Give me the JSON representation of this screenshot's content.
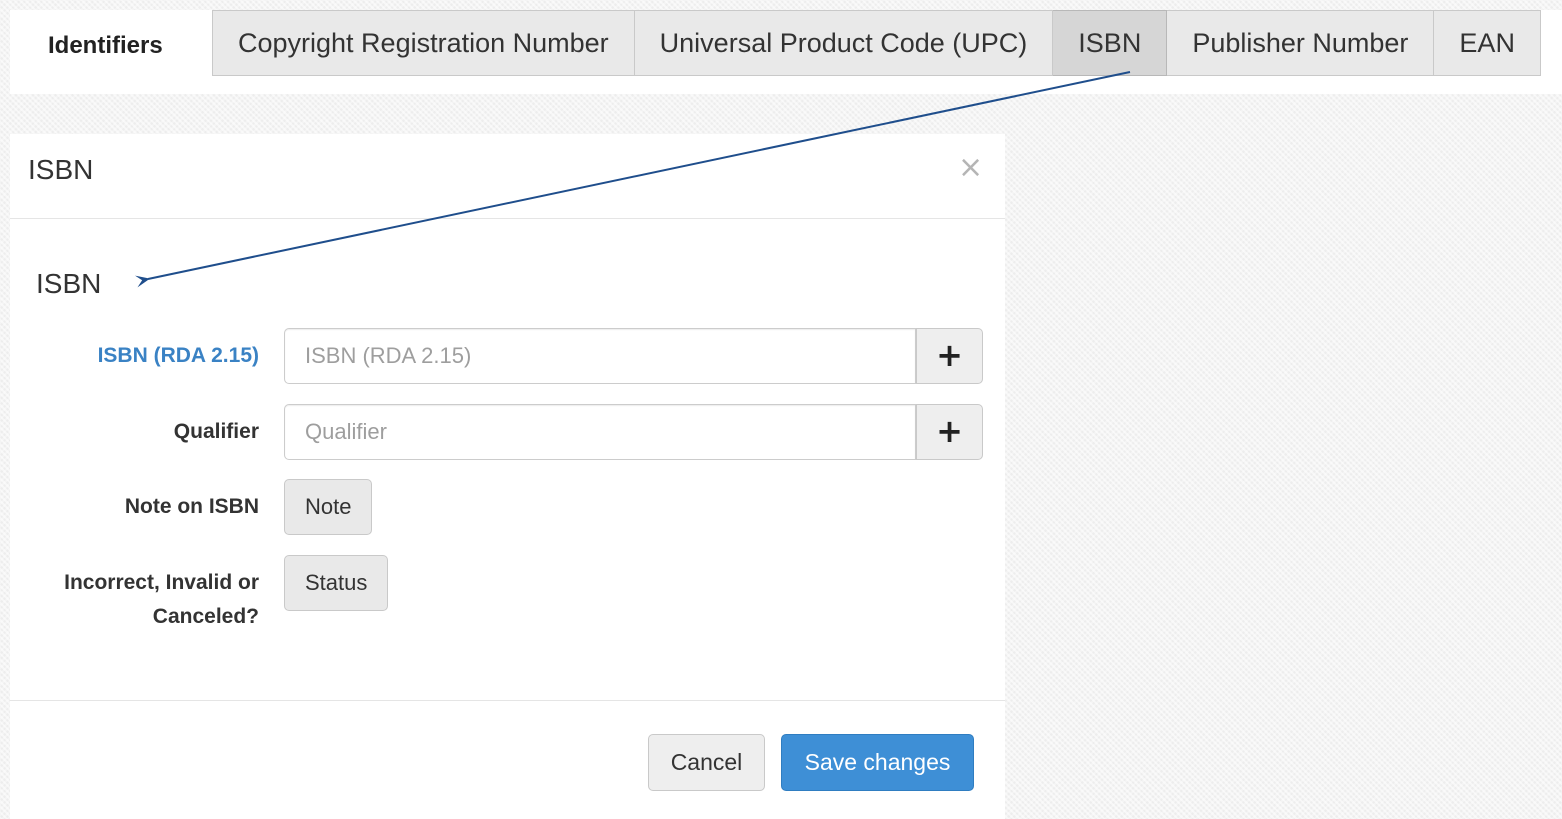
{
  "identifiers": {
    "section_label": "Identifiers",
    "tabs": [
      {
        "label": "Copyright Registration Number"
      },
      {
        "label": "Universal Product Code (UPC)"
      },
      {
        "label": "ISBN",
        "active": true
      },
      {
        "label": "Publisher Number"
      },
      {
        "label": "EAN"
      }
    ]
  },
  "modal": {
    "title": "ISBN",
    "close_icon": "×",
    "subheading": "ISBN",
    "fields": {
      "isbn": {
        "label": "ISBN (RDA 2.15)",
        "placeholder": "ISBN (RDA 2.15)",
        "value": "",
        "add_label": "+"
      },
      "qualifier": {
        "label": "Qualifier",
        "placeholder": "Qualifier",
        "value": "",
        "add_label": "+"
      },
      "note": {
        "label": "Note on ISBN",
        "button": "Note"
      },
      "status": {
        "label_line1": "Incorrect, Invalid or",
        "label_line2": "Canceled?",
        "button": "Status"
      }
    },
    "footer": {
      "cancel": "Cancel",
      "save": "Save changes"
    }
  },
  "colors": {
    "accent_blue": "#3e8fd6",
    "label_blue": "#3a82c4",
    "arrow": "#1f4e8c"
  }
}
